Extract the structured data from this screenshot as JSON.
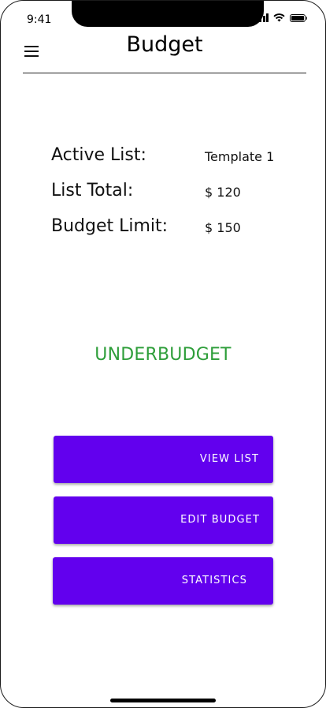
{
  "status_bar": {
    "time": "9:41"
  },
  "header": {
    "title": "Budget",
    "menu_icon": "hamburger-menu-icon"
  },
  "summary": {
    "active_list_label": "Active List:",
    "active_list_value": "Template 1",
    "list_total_label": "List Total:",
    "list_total_value": "$ 120",
    "budget_limit_label": "Budget Limit:",
    "budget_limit_value": "$ 150"
  },
  "budget_status": {
    "text": "UNDERBUDGET",
    "color": "#2e9e3a"
  },
  "actions": {
    "view_list_label": "VIEW LIST",
    "edit_budget_label": "EDIT BUDGET",
    "statistics_label": "STATISTICS",
    "button_color": "#6200ee"
  }
}
